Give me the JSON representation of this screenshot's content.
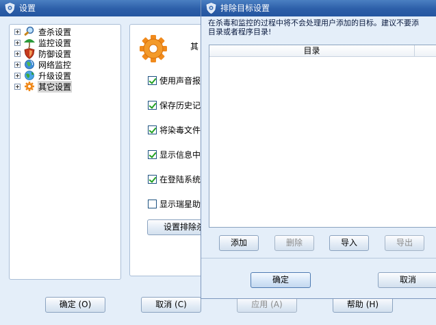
{
  "main_window": {
    "title": "设置",
    "tree": [
      {
        "label": "查杀设置",
        "icon": "magnifier-icon"
      },
      {
        "label": "监控设置",
        "icon": "umbrella-icon"
      },
      {
        "label": "防御设置",
        "icon": "shield-icon"
      },
      {
        "label": "网络监控",
        "icon": "network-globe-icon"
      },
      {
        "label": "升级设置",
        "icon": "update-globe-icon"
      },
      {
        "label": "其它设置",
        "icon": "gear-icon",
        "selected": true
      }
    ],
    "section_title": "其",
    "options": [
      {
        "label": "使用声音报",
        "checked": true
      },
      {
        "label": "保存历史记",
        "checked": true
      },
      {
        "label": "将染毒文件",
        "checked": true
      },
      {
        "label": "显示信息中",
        "checked": true
      },
      {
        "label": "在登陆系统",
        "checked": true
      },
      {
        "label": "显示瑞星助",
        "checked": false
      }
    ],
    "exclude_button": "设置排除杀毒",
    "buttons": {
      "ok": "确定 (O)",
      "cancel": "取消 (C)",
      "apply": "应用 (A)",
      "help": "帮助 (H)"
    }
  },
  "dialog": {
    "title": "排除目标设置",
    "description_line1": "在杀毒和监控的过程中将不会处理用户添加的目标。建议不要添",
    "description_line2": "目录或者程序目录!",
    "column_header": "目录",
    "buttons": {
      "add": "添加",
      "delete": "删除",
      "import": "导入",
      "export": "导出",
      "ok": "确定",
      "cancel": "取消"
    }
  },
  "colors": {
    "titlebar": "#2c5ea8",
    "window_bg": "#e4eef9",
    "check_green": "#21a121"
  }
}
